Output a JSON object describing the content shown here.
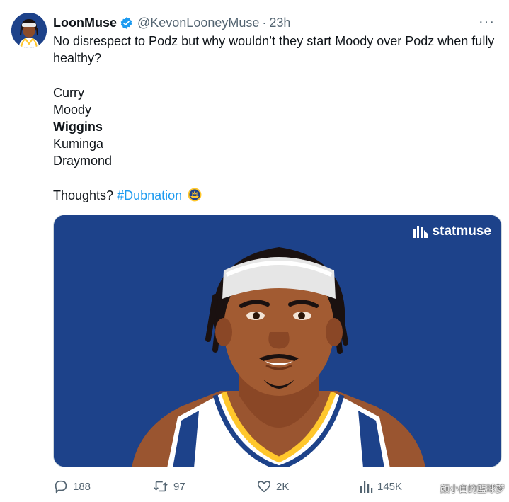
{
  "tweet": {
    "display_name": "LoonMuse",
    "handle": "@KevonLooneyMuse",
    "separator": "·",
    "time": "23h",
    "lines": [
      "No disrespect to Podz but why wouldn’t they start Moody over Podz when fully healthy?",
      "Curry",
      "Moody",
      "Wiggins",
      "Kuminga",
      "Draymond"
    ],
    "closing_text": "Thoughts?",
    "hashtag": "#Dubnation"
  },
  "media": {
    "brand": "statmuse"
  },
  "actions": {
    "replies": "188",
    "reposts": "97",
    "likes": "2K",
    "views": "145K"
  },
  "watermark": "颜小白的篮球梦",
  "colors": {
    "accent": "#1d9bf0",
    "media_background": "#1d428a",
    "muted_text": "#536471"
  },
  "icons": [
    "verified-badge-icon",
    "more-icon",
    "warriors-logo-icon",
    "statmuse-logo-icon",
    "reply-icon",
    "repost-icon",
    "like-icon",
    "views-icon"
  ]
}
